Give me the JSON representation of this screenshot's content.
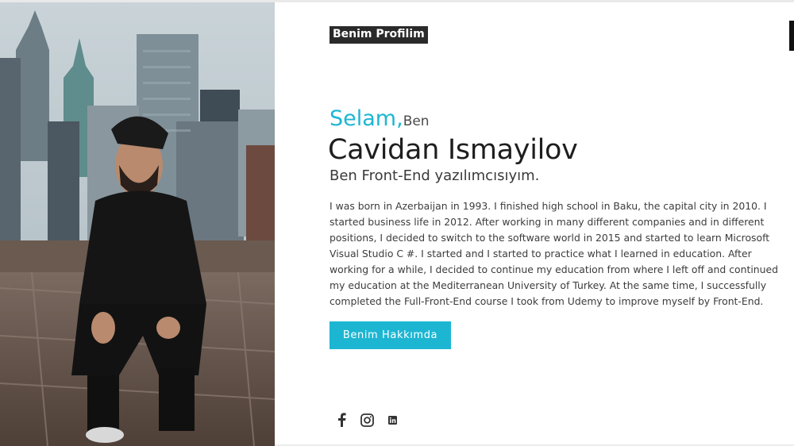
{
  "profile_label": "Benim Profilim",
  "hero": {
    "greeting_highlight": "Selam,",
    "greeting_rest": "Ben",
    "name": "Cavidan Ismayilov",
    "role": "Ben Front-End yazılımcısıyım.",
    "bio": "I was born in Azerbaijan in 1993. I finished high school in Baku, the capital city in 2010. I started business life in 2012. After working in many different companies and in different positions, I decided to switch to the software world in 2015 and started to learn Microsoft Visual Studio C #. I started and I started to practice what I learned in education. After working for a while, I decided to continue my education from where I left off and continued my education at the Mediterranean University of Turkey. At the same time, I successfully completed the Full-Front-End course I took from Udemy to improve myself by Front-End.",
    "button_label": "Benim Hakkımda"
  },
  "social": [
    {
      "icon": "facebook-icon"
    },
    {
      "icon": "instagram-icon"
    },
    {
      "icon": "linkedin-icon"
    }
  ],
  "colors": {
    "accent": "#1cb6d3",
    "label_bg": "#2a2a2a",
    "text_dark": "#1e1e1e"
  }
}
